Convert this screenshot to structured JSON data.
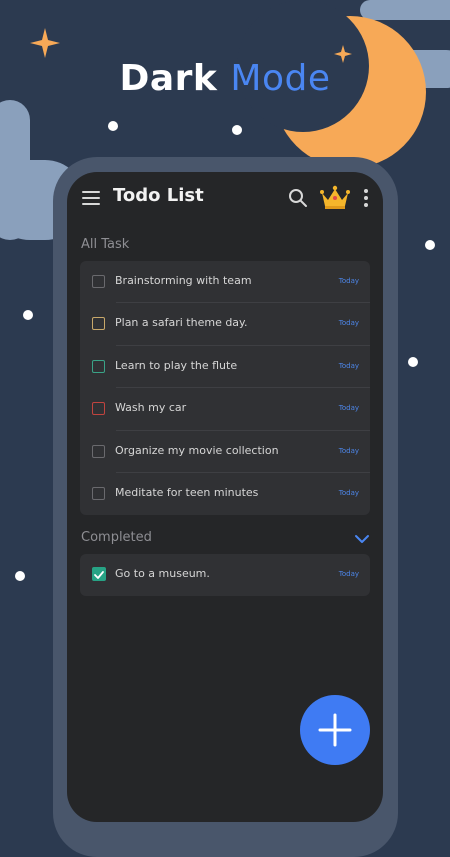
{
  "banner": {
    "word1": "Dark",
    "word2": "Mode"
  },
  "app": {
    "title": "Todo List",
    "icons": [
      "menu-icon",
      "search-icon",
      "crown-icon",
      "more-vert-icon"
    ]
  },
  "all_tasks": {
    "label": "All Task",
    "items": [
      {
        "text": "Brainstorming with team",
        "date": "Today",
        "checkbox_color": "#6a6a6e"
      },
      {
        "text": "Plan a safari theme day.",
        "date": "Today",
        "checkbox_color": "#c8a86a"
      },
      {
        "text": "Learn to play the flute",
        "date": "Today",
        "checkbox_color": "#3aa387"
      },
      {
        "text": "Wash my car",
        "date": "Today",
        "checkbox_color": "#c0443f"
      },
      {
        "text": "Organize my movie collection",
        "date": "Today",
        "checkbox_color": "#6a6a6e"
      },
      {
        "text": "Meditate for teen minutes",
        "date": "Today",
        "checkbox_color": "#6a6a6e"
      }
    ]
  },
  "completed": {
    "label": "Completed",
    "items": [
      {
        "text": "Go to a museum.",
        "date": "Today",
        "checked": true
      }
    ]
  },
  "colors": {
    "background": "#2c3a50",
    "accent": "#4a86f2",
    "moon": "#f7a957",
    "card": "#303134",
    "screen": "#252628"
  }
}
